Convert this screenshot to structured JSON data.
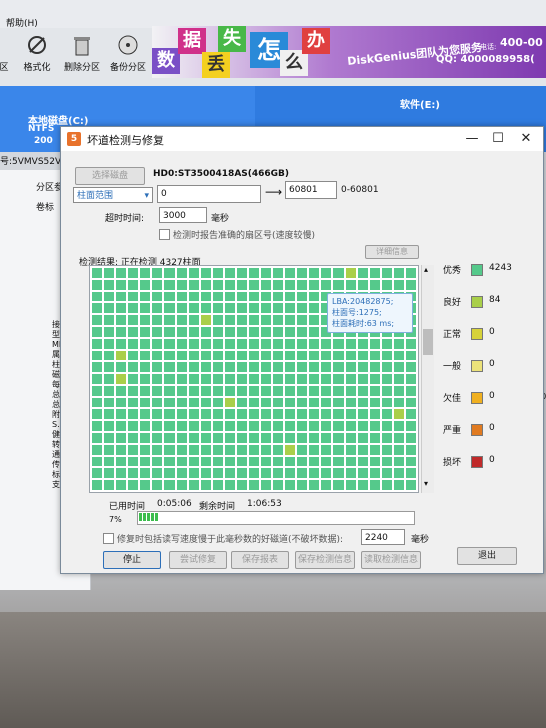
{
  "app": {
    "menu_help": "帮助(H)",
    "toolbar": [
      "区",
      "格式化",
      "删除分区",
      "备份分区"
    ],
    "banner": {
      "slogan_chars": [
        "数",
        "据",
        "丢",
        "失",
        "怎",
        "么",
        "办"
      ],
      "team_text": "DiskGenius团队为您服务",
      "phone": "400-00",
      "qq": "QQ: 4000089958(",
      "phone_label": "电话:"
    },
    "disk_left": {
      "name": "本地磁盘(C:)",
      "fs": "NTFS",
      "size": "200"
    },
    "disk_right": {
      "name": "软件(E:)"
    },
    "disk_model_short": "号:5VMVS52V",
    "tree_header": "分区参",
    "tree_item": "卷标",
    "left_info": [
      "接口类",
      "型号:",
      "MBR签名",
      "属性:",
      "柱面数",
      "磁头数",
      "每道扇",
      "总容量",
      "总扇区",
      "附加扇",
      "S.M.A",
      "健康状",
      "转速:",
      "通电时",
      "传输模",
      "标准:",
      "支持的"
    ],
    "right_edge_num": "50"
  },
  "dialog": {
    "title": "坏道检测与修复",
    "select_disk_btn": "选择磁盘",
    "disk_label": "HD0:ST3500418AS(466GB)",
    "range_select": "柱面范围",
    "range_start": "0",
    "range_end": "60801",
    "range_hint": "0-60801",
    "timeout_label": "超时时间:",
    "timeout_value": "3000",
    "timeout_unit": "毫秒",
    "report_checkbox": "检测时报告准确的扇区号(速度较慢)",
    "details_btn": "详细信息",
    "result_label": "检测结果: 正在检测 4327柱面",
    "tooltip": [
      "LBA:20482875;",
      "柱面号:1275;",
      "柱面耗时:63 ms;"
    ],
    "legend": [
      {
        "label": "优秀",
        "color": "#55c98b",
        "count": "4243"
      },
      {
        "label": "良好",
        "color": "#a9cf4a",
        "count": "84"
      },
      {
        "label": "正常",
        "color": "#d6d23a",
        "count": "0"
      },
      {
        "label": "一般",
        "color": "#ece27a",
        "count": "0"
      },
      {
        "label": "欠佳",
        "color": "#f0b020",
        "count": "0"
      },
      {
        "label": "严重",
        "color": "#e07a20",
        "count": "0"
      },
      {
        "label": "损坏",
        "color": "#c02a2a",
        "count": "0"
      }
    ],
    "elapsed_label": "已用时间",
    "elapsed_value": "0:05:06",
    "remaining_label": "剩余时间",
    "remaining_value": "1:06:53",
    "progress_percent": "7%",
    "progress_value": 0.07,
    "repair_checkbox": "修复时包括读写速度慢于此毫秒数的好磁道(不破坏数据):",
    "repair_ms": "2240",
    "repair_unit": "毫秒",
    "buttons": {
      "stop": "停止",
      "try_repair": "尝试修复",
      "save_report": "保存报表",
      "save_info": "保存检测信息",
      "read_info": "读取检测信息",
      "exit": "退出"
    }
  }
}
